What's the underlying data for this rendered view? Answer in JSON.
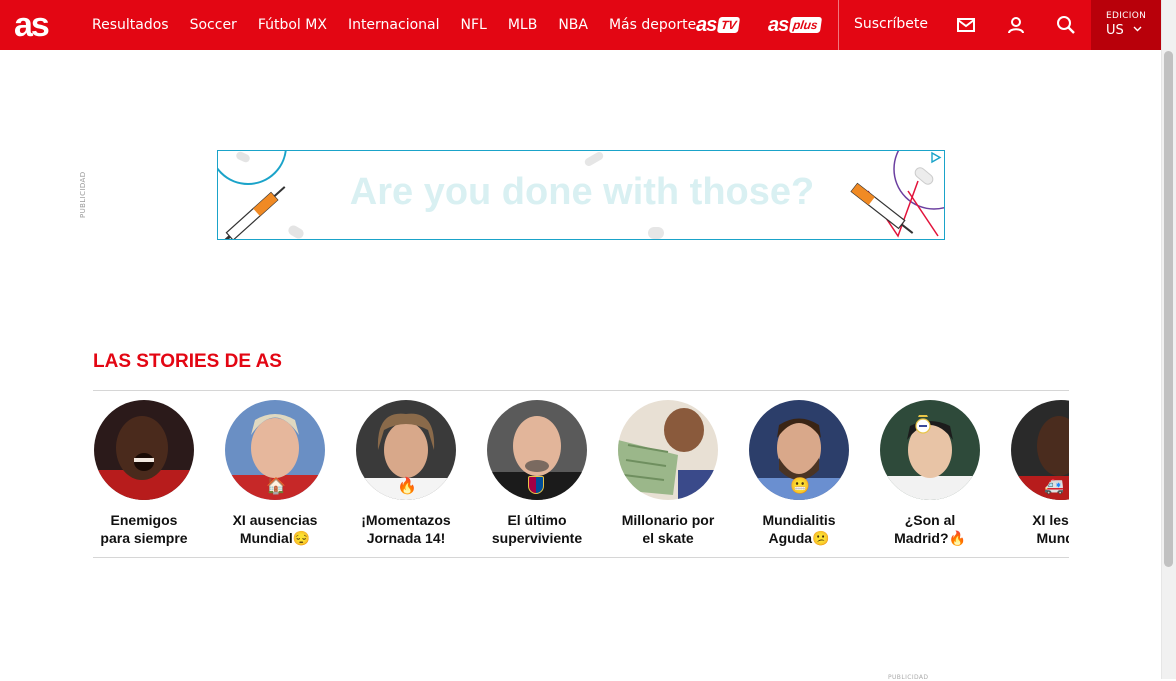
{
  "header": {
    "logo": "as",
    "nav": [
      "Resultados",
      "Soccer",
      "Fútbol MX",
      "Internacional",
      "NFL",
      "MLB",
      "NBA",
      "Más deporte"
    ],
    "as_tv": {
      "word": "as",
      "chip": "TV"
    },
    "as_plus": {
      "word": "as",
      "chip": "plus"
    },
    "subscribe_label": "Suscríbete",
    "edition_label": "EDICION",
    "edition_value": "US"
  },
  "ad": {
    "publicidad_label": "PUBLICIDAD",
    "headline": "Are you done with those?",
    "accent": "#1aa3c9"
  },
  "stories": {
    "title": "LAS STORIES DE AS",
    "items": [
      {
        "line1": "Enemigos",
        "line2": "para siempre",
        "emoji": ""
      },
      {
        "line1": "XI ausencias",
        "line2": "Mundial😔",
        "emoji": "🏠"
      },
      {
        "line1": "¡Momentazos",
        "line2": "Jornada 14!",
        "emoji": "🔥"
      },
      {
        "line1": "El último",
        "line2": "superviviente",
        "emoji": ""
      },
      {
        "line1": "Millonario por",
        "line2": "el skate",
        "emoji": ""
      },
      {
        "line1": "Mundialitis",
        "line2": "Aguda😕",
        "emoji": "😬"
      },
      {
        "line1": "¿Son al",
        "line2": "Madrid?🔥",
        "emoji": ""
      },
      {
        "line1": "XI lesion",
        "line2": "Mundia",
        "emoji": "🚑"
      }
    ]
  },
  "footer": {
    "publicidad_label": "PUBLICIDAD"
  },
  "colors": {
    "brand": "#e30613",
    "edition_bg": "#b8000a"
  }
}
